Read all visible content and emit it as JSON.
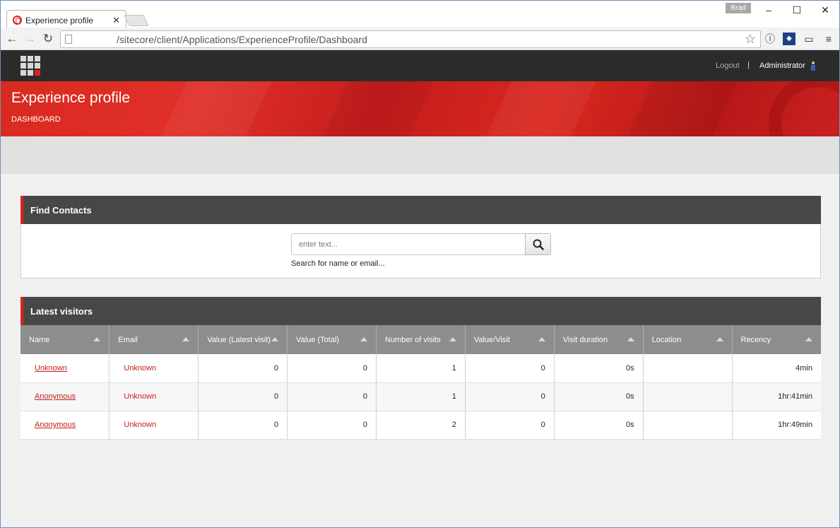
{
  "browser": {
    "tab_title": "Experience profile",
    "user_badge": "Brad",
    "url": "/sitecore/client/Applications/ExperienceProfile/Dashboard"
  },
  "header": {
    "logout": "Logout",
    "separator": "|",
    "user": "Administrator"
  },
  "banner": {
    "title": "Experience profile",
    "subtitle": "DASHBOARD"
  },
  "find_contacts": {
    "title": "Find Contacts",
    "placeholder": "enter text...",
    "hint": "Search for name or email..."
  },
  "latest_visitors": {
    "title": "Latest visitors",
    "columns": [
      "Name",
      "Email",
      "Value (Latest visit)",
      "Value (Total)",
      "Number of visits",
      "Value/Visit",
      "Visit duration",
      "Location",
      "Recency"
    ],
    "rows": [
      {
        "name": "Unknown",
        "email": "Unknown",
        "value_latest": "0",
        "value_total": "0",
        "visits": "1",
        "value_per_visit": "0",
        "duration": "0s",
        "location": "",
        "recency": "4min"
      },
      {
        "name": "Anonymous",
        "email": "Unknown",
        "value_latest": "0",
        "value_total": "0",
        "visits": "1",
        "value_per_visit": "0",
        "duration": "0s",
        "location": "",
        "recency": "1hr:41min"
      },
      {
        "name": "Anonymous",
        "email": "Unknown",
        "value_latest": "0",
        "value_total": "0",
        "visits": "2",
        "value_per_visit": "0",
        "duration": "0s",
        "location": "",
        "recency": "1hr:49min"
      }
    ]
  },
  "colors": {
    "accent": "#e32119",
    "highlight": "#f9f400"
  }
}
